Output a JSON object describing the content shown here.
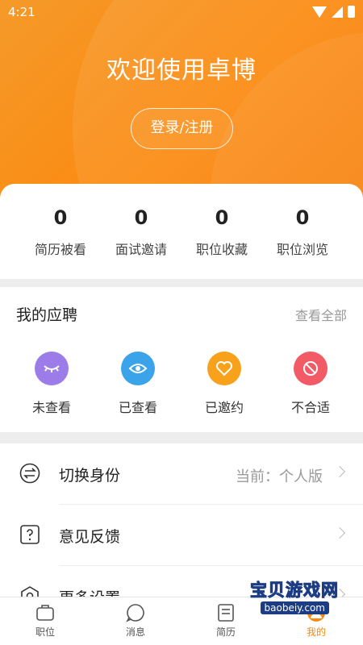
{
  "status_bar": {
    "time": "4:21"
  },
  "header": {
    "welcome": "欢迎使用卓博",
    "login_button": "登录/注册"
  },
  "stats": [
    {
      "value": "0",
      "label": "简历被看"
    },
    {
      "value": "0",
      "label": "面试邀请"
    },
    {
      "value": "0",
      "label": "职位收藏"
    },
    {
      "value": "0",
      "label": "职位浏览"
    }
  ],
  "applications": {
    "title": "我的应聘",
    "view_all": "查看全部",
    "items": [
      {
        "label": "未查看",
        "icon": "closed-eye-icon",
        "color": "#9b7ce8"
      },
      {
        "label": "已查看",
        "icon": "eye-icon",
        "color": "#3aa3ea"
      },
      {
        "label": "已邀约",
        "icon": "heart-icon",
        "color": "#f7a21a"
      },
      {
        "label": "不合适",
        "icon": "ban-icon",
        "color": "#f25a65"
      }
    ]
  },
  "menu": [
    {
      "label": "切换身份",
      "value": "当前：个人版",
      "icon": "switch-icon"
    },
    {
      "label": "意见反馈",
      "value": "",
      "icon": "feedback-icon"
    },
    {
      "label": "更多设置",
      "value": "",
      "icon": "settings-icon"
    }
  ],
  "tabbar": [
    {
      "label": "职位",
      "icon": "briefcase-icon"
    },
    {
      "label": "消息",
      "icon": "message-icon"
    },
    {
      "label": "简历",
      "icon": "resume-icon"
    },
    {
      "label": "我的",
      "icon": "user-icon",
      "active": true
    }
  ],
  "watermark": {
    "text": "宝贝游戏网",
    "url": "baobeiy.com"
  },
  "colors": {
    "accent": "#f98a10",
    "header_start": "#f59a2a",
    "header_end": "#f77a00"
  }
}
